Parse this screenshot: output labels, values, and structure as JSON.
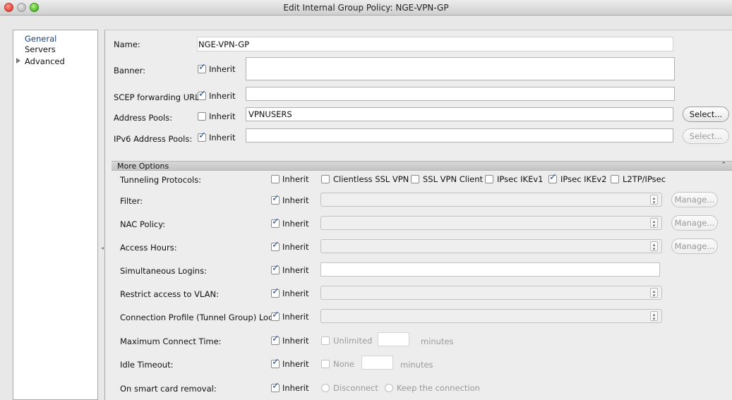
{
  "window": {
    "title": "Edit Internal Group Policy: NGE-VPN-GP"
  },
  "sidebar": {
    "items": [
      {
        "label": "General"
      },
      {
        "label": "Servers"
      },
      {
        "label": "Advanced"
      }
    ]
  },
  "general": {
    "name_label": "Name:",
    "name_value": "NGE-VPN-GP",
    "banner_label": "Banner:",
    "scep_label": "SCEP forwarding URL:",
    "address_pools_label": "Address Pools:",
    "address_pools_value": "VPNUSERS",
    "ipv6_pools_label": "IPv6 Address Pools:",
    "inherit_label": "Inherit",
    "select_label": "Select..."
  },
  "more_options": {
    "title": "More Options",
    "inherit_label": "Inherit",
    "manage_label": "Manage...",
    "tunneling_label": "Tunneling Protocols:",
    "protocols": [
      {
        "label": "Clientless SSL VPN",
        "checked": false
      },
      {
        "label": "SSL VPN Client",
        "checked": false
      },
      {
        "label": "IPsec IKEv1",
        "checked": false
      },
      {
        "label": "IPsec IKEv2",
        "checked": true
      },
      {
        "label": "L2TP/IPsec",
        "checked": false
      }
    ],
    "filter_label": "Filter:",
    "nac_label": "NAC Policy:",
    "access_hours_label": "Access Hours:",
    "sim_logins_label": "Simultaneous Logins:",
    "vlan_label": "Restrict access to VLAN:",
    "conn_profile_label": "Connection Profile (Tunnel Group) Lock:",
    "max_connect_label": "Maximum Connect Time:",
    "unlimited_label": "Unlimited",
    "minutes_label": "minutes",
    "idle_label": "Idle Timeout:",
    "none_label": "None",
    "smartcard_label": "On smart card removal:",
    "disconnect_label": "Disconnect",
    "keep_label": "Keep the connection"
  }
}
